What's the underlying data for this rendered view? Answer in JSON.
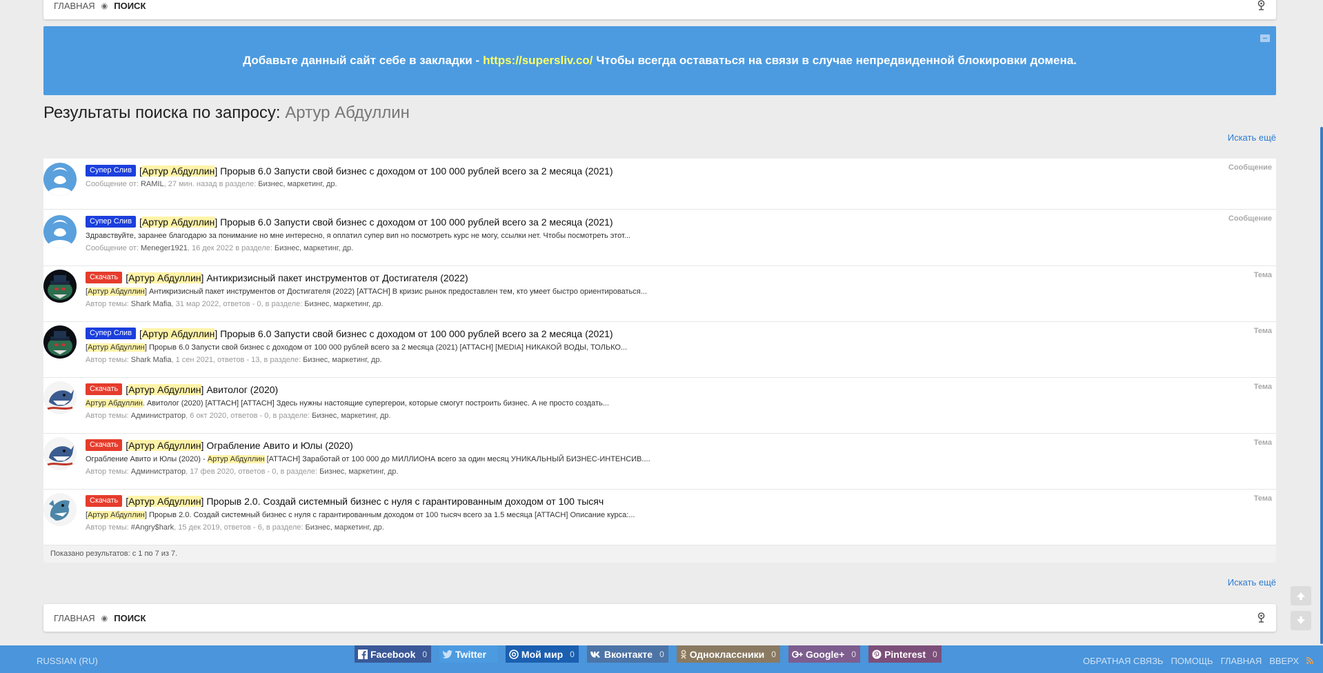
{
  "breadcrumb": {
    "home": "ГЛАВНАЯ",
    "current": "ПОИСК"
  },
  "notice": {
    "before": "Добавьте данный сайт себе в закладки -",
    "link": "https://supersliv.co/",
    "after": "Чтобы всегда оставаться на связи в случае непредвиденной блокировки домена."
  },
  "page": {
    "title_prefix": "Результаты поиска по запросу:",
    "query": "Артур Абдуллин",
    "search_more": "Искать ещё"
  },
  "results": [
    {
      "type": "Сообщение",
      "prefix": "Супер Слив",
      "prefix_color": "#1b3fdd",
      "avatar": "default",
      "hl": "Артур Абдуллин",
      "title": "Прорыв 6.0 Запусти свой бизнес с доходом от 100 000 рублей всего за 2 месяца (2021)",
      "snippet_hl": "",
      "snippet": "",
      "meta_label": "Сообщение от:",
      "author": "RAMIL",
      "date": "27 мин. назад",
      "stats": "",
      "in_section": "в разделе:",
      "section": "Бизнес, маркетинг, др."
    },
    {
      "type": "Сообщение",
      "prefix": "Супер Слив",
      "prefix_color": "#1b3fdd",
      "avatar": "default",
      "hl": "Артур Абдуллин",
      "title": "Прорыв 6.0 Запусти свой бизнес с доходом от 100 000 рублей всего за 2 месяца (2021)",
      "snippet_hl": "",
      "snippet": "Здравствуйте, заранее благодарю за понимание но мне интересно, я оплатил супер вип но посмотреть курс не могу, ссылки нет. Чтобы посмотреть этот...",
      "meta_label": "Сообщение от:",
      "author": "Meneger1921",
      "date": "16 дек 2022",
      "stats": "",
      "in_section": "в разделе:",
      "section": "Бизнес, маркетинг, др."
    },
    {
      "type": "Тема",
      "prefix": "Скачать",
      "prefix_color": "#e53c2c",
      "avatar": "mafia",
      "hl": "Артур Абдуллин",
      "title": "Антикризисный пакет инструментов от Достигателя (2022)",
      "snippet_hl": "Артур Абдуллин",
      "snippet": "Антикризисный пакет инструментов от Достигателя (2022) [ATTACH] В кризис рынок предоставлен тем, кто умеет быстро ориентироваться...",
      "meta_label": "Автор темы:",
      "author": "Shark Mafia",
      "date": "31 мар 2022",
      "stats": "ответов - 0",
      "in_section": "в разделе:",
      "section": "Бизнес, маркетинг, др."
    },
    {
      "type": "Тема",
      "prefix": "Супер Слив",
      "prefix_color": "#1b3fdd",
      "avatar": "mafia",
      "hl": "Артур Абдуллин",
      "title": "Прорыв 6.0 Запусти свой бизнес с доходом от 100 000 рублей всего за 2 месяца (2021)",
      "snippet_hl": "Артур Абдуллин",
      "snippet": "Прорыв 6.0 Запусти свой бизнес с доходом от 100 000 рублей всего за 2 месяца (2021) [ATTACH] [MEDIA] НИКАКОЙ ВОДЫ, ТОЛЬКО...",
      "meta_label": "Автор темы:",
      "author": "Shark Mafia",
      "date": "1 сен 2021",
      "stats": "ответов - 13",
      "in_section": "в разделе:",
      "section": "Бизнес, маркетинг, др."
    },
    {
      "type": "Тема",
      "prefix": "Скачать",
      "prefix_color": "#e53c2c",
      "avatar": "shark-admin",
      "hl": "Артур Абдуллин",
      "title": "Авитолог (2020)",
      "snippet_hl": "Артур Абдуллин",
      "snippet": ". Авитолог (2020) [ATTACH] [ATTACH] Здесь нужны настоящие супергерои, которые смогут построить бизнес. А не просто создать...",
      "meta_label": "Автор темы:",
      "author": "Администратор",
      "date": "6 окт 2020",
      "stats": "ответов - 0",
      "in_section": "в разделе:",
      "section": "Бизнес, маркетинг, др."
    },
    {
      "type": "Тема",
      "prefix": "Скачать",
      "prefix_color": "#e53c2c",
      "avatar": "shark-admin",
      "hl": "Артур Абдуллин",
      "title": "Ограбление Авито и Юлы (2020)",
      "snippet_hl": "",
      "snippet": "Ограбление Авито и Юлы (2020) - Артур Абдуллин [ATTACH] Заработай от 100 000 до МИЛЛИОНА всего за один месяц УНИКАЛЬНЫЙ БИЗНЕС-ИНТЕНСИВ....",
      "meta_label": "Автор темы:",
      "author": "Администратор",
      "date": "17 фев 2020",
      "stats": "ответов - 0",
      "in_section": "в разделе:",
      "section": "Бизнес, маркетинг, др."
    },
    {
      "type": "Тема",
      "prefix": "Скачать",
      "prefix_color": "#e53c2c",
      "avatar": "shark-angry",
      "hl": "Артур Абдуллин",
      "title": "Прорыв 2.0. Создай системный бизнес с нуля с гарантированным доходом от 100 тысяч",
      "snippet_hl": "Артур Абдуллин",
      "snippet": "Прорыв 2.0. Создай системный бизнес с нуля с гарантированным доходом от 100 тысяч всего за 1.5 месяца [ATTACH] Описание курса:...",
      "meta_label": "Автор темы:",
      "author": "#Angry$hark",
      "date": "15 дек 2019",
      "stats": "ответов - 6",
      "in_section": "в разделе:",
      "section": "Бизнес, маркетинг, др."
    }
  ],
  "results_footer": "Показано результатов: с 1 по 7 из 7.",
  "footer": {
    "language": "RUSSIAN (RU)",
    "nav": [
      "ОБРАТНАЯ СВЯЗЬ",
      "ПОМОЩЬ",
      "ГЛАВНАЯ",
      "ВВЕРХ"
    ],
    "shares": [
      {
        "name": "Facebook",
        "count": "0",
        "color": "#3b5998",
        "icon": "facebook-icon"
      },
      {
        "name": "Twitter",
        "count": "",
        "color": "#4c9be0",
        "icon": "twitter-icon"
      },
      {
        "name": "Мой мир",
        "count": "0",
        "color": "#1b5fb0",
        "icon": "moimir-icon"
      },
      {
        "name": "Вконтакте",
        "count": "0",
        "color": "#4d74a6",
        "icon": "vk-icon"
      },
      {
        "name": "Одноклассники",
        "count": "0",
        "color": "#8a7a62",
        "icon": "ok-icon"
      },
      {
        "name": "Google+",
        "count": "0",
        "color": "#7d5e8f",
        "icon": "googleplus-icon"
      },
      {
        "name": "Pinterest",
        "count": "0",
        "color": "#7c4f7a",
        "icon": "pinterest-icon"
      }
    ]
  }
}
